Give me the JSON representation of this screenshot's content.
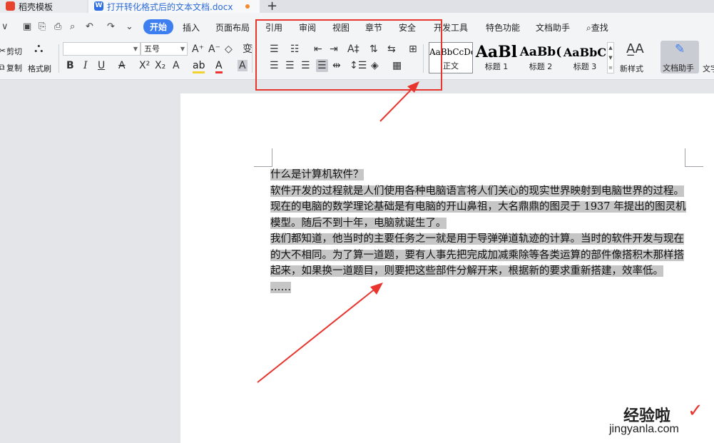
{
  "tabs": [
    {
      "label": "稻壳模板"
    },
    {
      "label": "打开转化格式后的文本文档.docx"
    }
  ],
  "tab_add": "+",
  "menu": {
    "items": [
      "开始",
      "插入",
      "页面布局",
      "引用",
      "审阅",
      "视图",
      "章节",
      "安全",
      "开发工具",
      "特色功能",
      "文档助手"
    ],
    "search": "查找"
  },
  "ribbon": {
    "cut": "剪切",
    "copy": "复制",
    "format_painter": "格式刷",
    "font_name": "",
    "font_size": "五号",
    "styles": [
      {
        "sample": "AaBbCcDd",
        "name": "正文"
      },
      {
        "sample": "AaBl",
        "name": "标题 1"
      },
      {
        "sample": "AaBb(",
        "name": "标题 2"
      },
      {
        "sample": "AaBbC",
        "name": "标题 3"
      }
    ],
    "new_style": "新样式",
    "doc_assistant": "文档助手",
    "text_tools": "文字"
  },
  "document": {
    "lines": [
      "什么是计算机软件？",
      "软件开发的过程就是人们使用各种电脑语言将人们关心的现实世界映射到电脑世界的过程。",
      "现在的电脑的数学理论基础是有电脑的开山鼻祖，大名鼎鼎的图灵于 1937 年提出的图灵机",
      "模型。随后不到十年，电脑就诞生了。",
      "我们都知道，他当时的主要任务之一就是用于导弹弹道轨迹的计算。当时的软件开发与现在",
      "的大不相同。为了算一道题，要有人事先把完成加减乘除等各类运算的部件像搭积木那样搭",
      "起来，如果换一道题目，则要把这些部件分解开来，根据新的要求重新搭建，效率低。",
      "……"
    ]
  },
  "watermark": {
    "title": "经验啦",
    "check": "✓",
    "url": "jingyanla.com"
  },
  "colors": {
    "accent": "#3d7ef0",
    "highlight_box": "#e8362f",
    "selection": "#c6c6c6"
  }
}
